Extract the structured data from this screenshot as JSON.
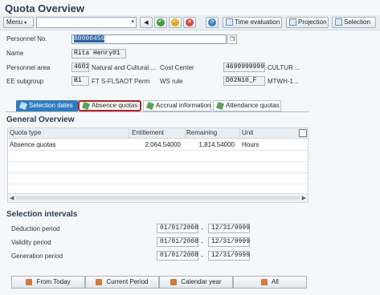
{
  "app": {
    "title": "Quota Overview"
  },
  "toolbar": {
    "menu_label": "Menu",
    "time_evaluation_label": "Time evaluation",
    "projection_label": "Projection",
    "selection_label": "Selection"
  },
  "header": {
    "personnel_no_label": "Personnel No.",
    "personnel_no_value": "80000456",
    "name_label": "Name",
    "name_value": "Rita Henry01",
    "personnel_area_label": "Personnel area",
    "personnel_area_code": "4601",
    "personnel_area_text": "Natural and Cultural ...",
    "cost_center_label": "Cost Center",
    "cost_center_code": "4699999999",
    "cost_center_text": "CULTUR ...",
    "ee_subgroup_label": "EE subgroup",
    "ee_subgroup_code": "B1",
    "ee_subgroup_text": "FT S-FLSAOT Perm",
    "ws_rule_label": "WS rule",
    "ws_rule_code": "D02N10_F",
    "ws_rule_text": "MTWH-1..."
  },
  "tabs": [
    {
      "label": "Selection dates",
      "active": true
    },
    {
      "label": "Absence quotas",
      "highlighted": true
    },
    {
      "label": "Accrual information"
    },
    {
      "label": "Attendance quotas"
    }
  ],
  "general_overview": {
    "title": "General Overview",
    "columns": [
      "Quota type",
      "Entitlement",
      "Remaining",
      "Unit"
    ],
    "rows": [
      {
        "quota_type": "Absence quotas",
        "entitlement": "2,064.54000",
        "remaining": "1,814.54000",
        "unit": "Hours"
      }
    ]
  },
  "selection_intervals": {
    "title": "Selection intervals",
    "rows": [
      {
        "label": "Deduction period",
        "from": "01/01/2008",
        "to": "12/31/9999"
      },
      {
        "label": "Validity period",
        "from": "01/01/2008",
        "to": "12/31/9999"
      },
      {
        "label": "Generation period",
        "from": "01/01/2008",
        "to": "12/31/9999"
      }
    ],
    "separator": "-"
  },
  "bottom_buttons": [
    "From Today",
    "Current Period",
    "Calendar year",
    "All"
  ],
  "colors": {
    "tab_active": "#2f7bbf",
    "highlight_border": "#b32025",
    "title": "#2c3e50"
  }
}
